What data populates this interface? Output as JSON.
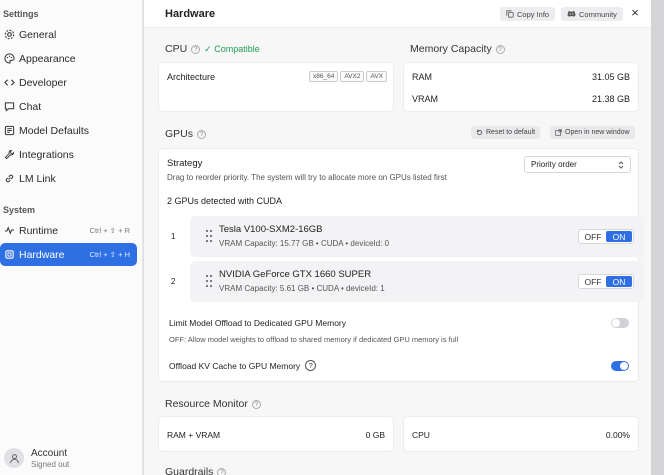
{
  "sidebar": {
    "settings_heading": "Settings",
    "system_heading": "System",
    "items": [
      {
        "label": "General",
        "icon": "gear-icon"
      },
      {
        "label": "Appearance",
        "icon": "palette-icon"
      },
      {
        "label": "Developer",
        "icon": "code-icon"
      },
      {
        "label": "Chat",
        "icon": "chat-icon"
      },
      {
        "label": "Model Defaults",
        "icon": "model-icon"
      },
      {
        "label": "Integrations",
        "icon": "wrench-icon"
      },
      {
        "label": "LM Link",
        "icon": "link-icon"
      }
    ],
    "system_items": [
      {
        "label": "Runtime",
        "shortcut": "Ctrl + ⇧ + R",
        "icon": "pulse-icon"
      },
      {
        "label": "Hardware",
        "shortcut": "Ctrl + ⇧ + H",
        "icon": "chip-icon",
        "active": true
      }
    ],
    "account": {
      "name": "Account",
      "status": "Signed out"
    }
  },
  "header": {
    "title": "Hardware",
    "copy_info": "Copy Info",
    "community": "Community",
    "close": "×"
  },
  "cpu": {
    "title": "CPU",
    "compatible": "✓ Compatible",
    "architecture_label": "Architecture",
    "chips": [
      "x86_64",
      "AVX2",
      "AVX"
    ]
  },
  "memory": {
    "title": "Memory Capacity",
    "ram_label": "RAM",
    "ram_value": "31.05 GB",
    "vram_label": "VRAM",
    "vram_value": "21.38 GB"
  },
  "gpus": {
    "title": "GPUs",
    "reset_label": "Reset to default",
    "open_window_label": "Open in new window",
    "strategy_label": "Strategy",
    "strategy_desc": "Drag to reorder priority. The system will try to allocate more on GPUs listed first",
    "strategy_value": "Priority order",
    "detected": "2 GPUs detected with CUDA",
    "off_label": "OFF",
    "on_label": "ON",
    "list": [
      {
        "index": "1",
        "name": "Tesla V100-SXM2-16GB",
        "details": "VRAM Capacity: 15.77 GB • CUDA • deviceId: 0",
        "enabled": true
      },
      {
        "index": "2",
        "name": "NVIDIA GeForce GTX 1660 SUPER",
        "details": "VRAM Capacity: 5.61 GB • CUDA • deviceId: 1",
        "enabled": true
      }
    ],
    "limit_offload_label": "Limit Model Offload to Dedicated GPU Memory",
    "limit_offload_desc": "OFF: Allow model weights to offload to shared memory if dedicated GPU memory is full",
    "limit_offload_enabled": false,
    "kv_cache_label": "Offload KV Cache to GPU Memory",
    "kv_cache_enabled": true
  },
  "resource_monitor": {
    "title": "Resource Monitor",
    "ram_vram_label": "RAM + VRAM",
    "ram_vram_value": "0 GB",
    "cpu_label": "CPU",
    "cpu_value": "0.00%"
  },
  "guardrails": {
    "title": "Guardrails"
  },
  "colors": {
    "accent": "#2f6fe4",
    "compatible": "#1f9d55"
  }
}
